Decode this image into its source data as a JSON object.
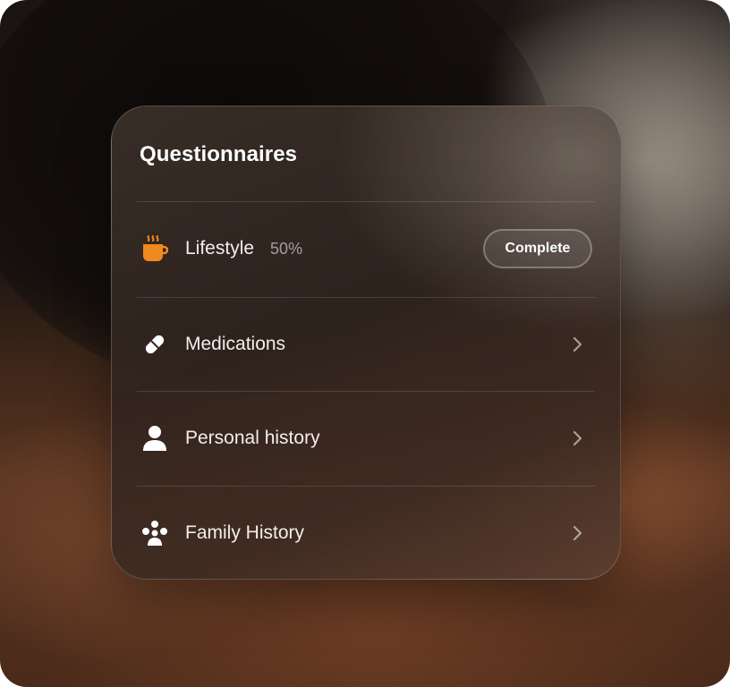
{
  "card": {
    "title": "Questionnaires",
    "items": [
      {
        "label": "Lifestyle",
        "progress": "50%",
        "action_label": "Complete",
        "icon": "coffee-cup-icon",
        "icon_color": "#F08A1C"
      },
      {
        "label": "Medications",
        "icon": "pill-icon",
        "icon_color": "#FFFFFF"
      },
      {
        "label": "Personal history",
        "icon": "person-icon",
        "icon_color": "#FFFFFF"
      },
      {
        "label": "Family History",
        "icon": "family-icon",
        "icon_color": "#FFFFFF"
      }
    ]
  },
  "colors": {
    "accent": "#F08A1C",
    "text": "#F3EEEA",
    "muted": "rgba(255,255,255,0.55)"
  }
}
